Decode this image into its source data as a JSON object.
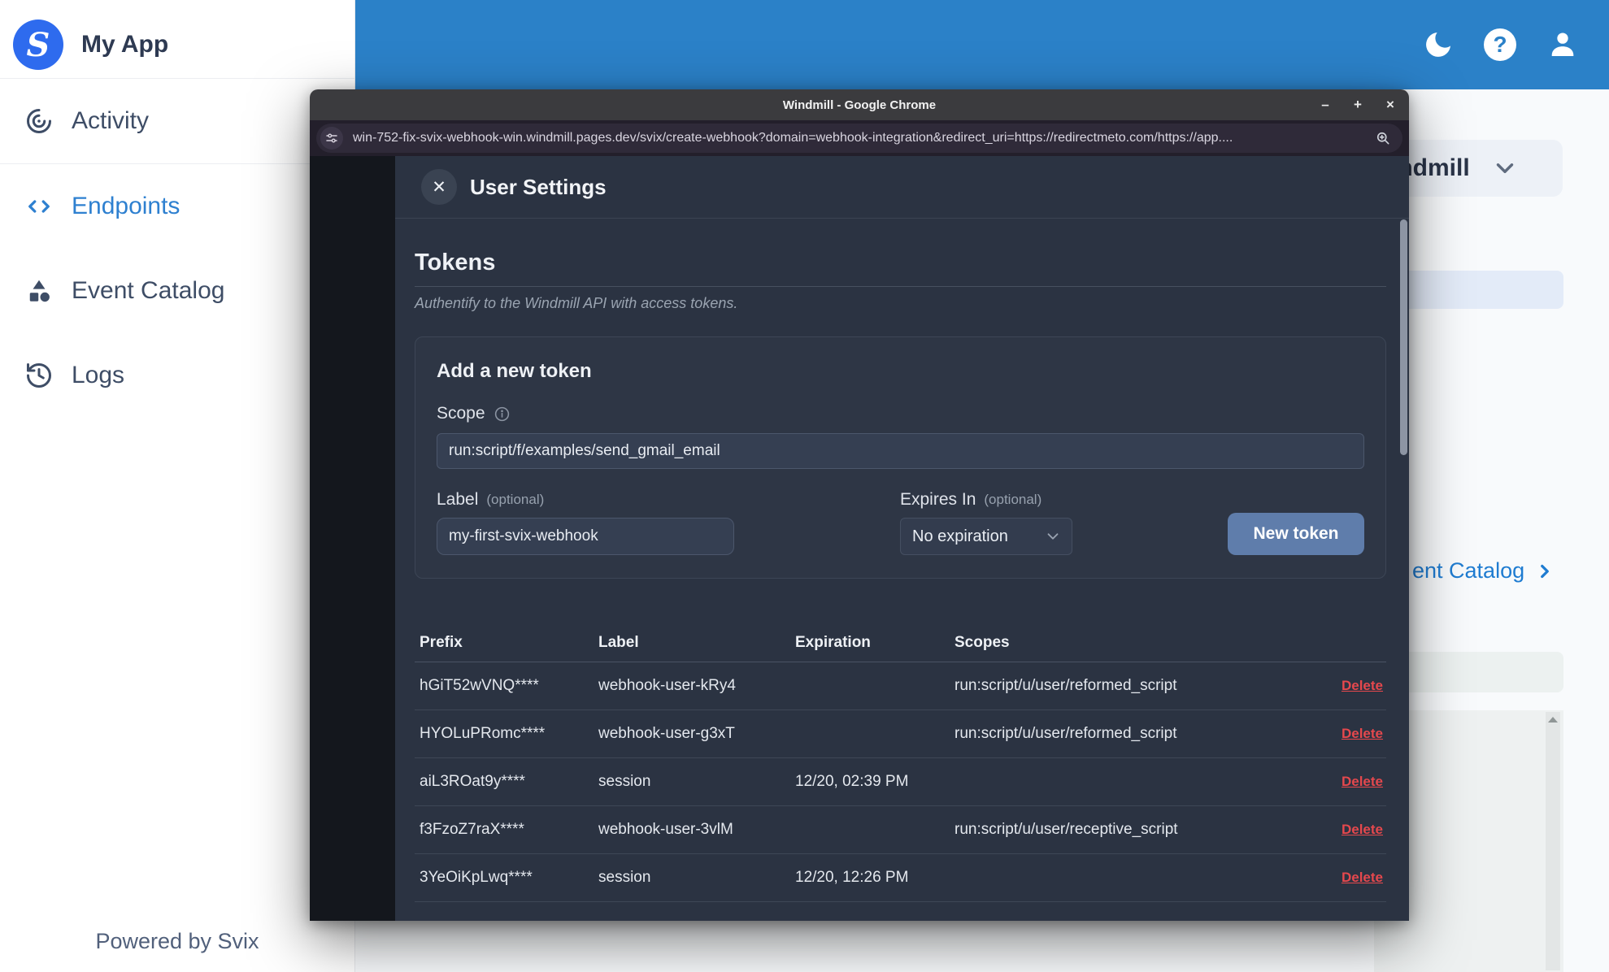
{
  "sidebar": {
    "logo_glyph": "S",
    "app_name": "My App",
    "items": [
      {
        "label": "Activity",
        "active": false
      },
      {
        "label": "Endpoints",
        "active": true
      },
      {
        "label": "Event Catalog",
        "active": false
      },
      {
        "label": "Logs",
        "active": false
      }
    ],
    "footer": "Powered by Svix"
  },
  "topbar": {
    "help_glyph": "?"
  },
  "background": {
    "workspace_name": "indmill",
    "catalog_link": "ent Catalog"
  },
  "window": {
    "title": "Windmill - Google Chrome",
    "controls": {
      "minimize": "–",
      "maximize": "+",
      "close": "×"
    },
    "url": "win-752-fix-svix-webhook-win.windmill.pages.dev/svix/create-webhook?domain=webhook-integration&redirect_uri=https://redirectmeto.com/https://app....",
    "modal": {
      "close_glyph": "✕",
      "title": "User Settings",
      "section_title": "Tokens",
      "section_subtitle": "Authentify to the Windmill API with access tokens.",
      "card": {
        "title": "Add a new token",
        "scope_label": "Scope",
        "scope_value": "run:script/f/examples/send_gmail_email",
        "label_label": "Label",
        "optional": "(optional)",
        "label_value": "my-first-svix-webhook",
        "expires_label": "Expires In",
        "expires_value": "No expiration",
        "button_label": "New token"
      },
      "table": {
        "headers": [
          "Prefix",
          "Label",
          "Expiration",
          "Scopes"
        ],
        "delete_label": "Delete",
        "rows": [
          {
            "prefix": "hGiT52wVNQ****",
            "label": "webhook-user-kRy4",
            "expiration": "",
            "scopes": "run:script/u/user/reformed_script"
          },
          {
            "prefix": "HYOLuPRomc****",
            "label": "webhook-user-g3xT",
            "expiration": "",
            "scopes": "run:script/u/user/reformed_script"
          },
          {
            "prefix": "aiL3ROat9y****",
            "label": "session",
            "expiration": "12/20, 02:39 PM",
            "scopes": ""
          },
          {
            "prefix": "f3FzoZ7raX****",
            "label": "webhook-user-3vlM",
            "expiration": "",
            "scopes": "run:script/u/user/receptive_script"
          },
          {
            "prefix": "3YeOiKpLwq****",
            "label": "session",
            "expiration": "12/20, 12:26 PM",
            "scopes": ""
          }
        ]
      }
    }
  },
  "colors": {
    "header_blue": "#2b81c8",
    "active_nav_blue": "#2e80d0",
    "logo_blue": "#2e6bee",
    "link_blue": "#1f7cd1",
    "drawer_bg": "#2b3342",
    "button_blue": "#5f7dab",
    "delete_red": "#e5484d"
  }
}
